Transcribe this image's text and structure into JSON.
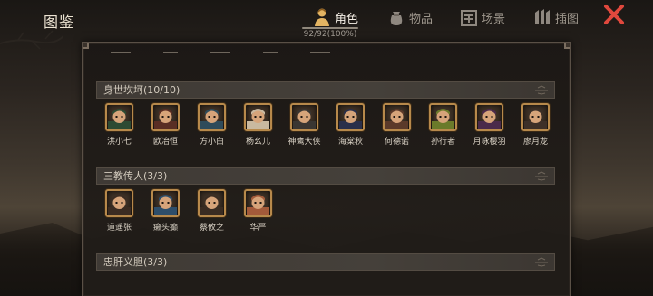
{
  "header": {
    "title": "图鉴",
    "progress": "92/92(100%)",
    "tabs": [
      {
        "label": "角色",
        "icon": "person-icon",
        "active": true
      },
      {
        "label": "物品",
        "icon": "bag-icon",
        "active": false
      },
      {
        "label": "场景",
        "icon": "scene-icon",
        "active": false
      },
      {
        "label": "插图",
        "icon": "illustration-icon",
        "active": false
      }
    ],
    "close_icon": "close-icon"
  },
  "sections": [
    {
      "title": "身世坎坷(10/10)",
      "characters": [
        {
          "name": "洪小七",
          "color": "#2d4a33"
        },
        {
          "name": "欧冶恒",
          "color": "#5a2e24"
        },
        {
          "name": "方小白",
          "color": "#2f4b5a"
        },
        {
          "name": "杨幺儿",
          "color": "#c9b9a0"
        },
        {
          "name": "神鹰大侠",
          "color": "#3a3632"
        },
        {
          "name": "海棠秋",
          "color": "#2a2f4a"
        },
        {
          "name": "何德诺",
          "color": "#5b3a2a"
        },
        {
          "name": "孙行者",
          "color": "#6a7a2a"
        },
        {
          "name": "月咏樱羽",
          "color": "#4a2a4a"
        },
        {
          "name": "廖月龙",
          "color": "#3d3028"
        }
      ]
    },
    {
      "title": "三教传人(3/3)",
      "characters": [
        {
          "name": "道遥张",
          "color": "#3b2c22"
        },
        {
          "name": "癞头癫",
          "color": "#2e4e6a"
        },
        {
          "name": "蔡攸之",
          "color": "#3a2c22"
        },
        {
          "name": "华严",
          "color": "#a35a3a"
        }
      ]
    },
    {
      "title": "忠肝义胆(3/3)",
      "characters": []
    }
  ],
  "colors": {
    "avatar_border": "#b7894b",
    "close": "#e0483d",
    "active_tab_icon": "#e3b462"
  }
}
